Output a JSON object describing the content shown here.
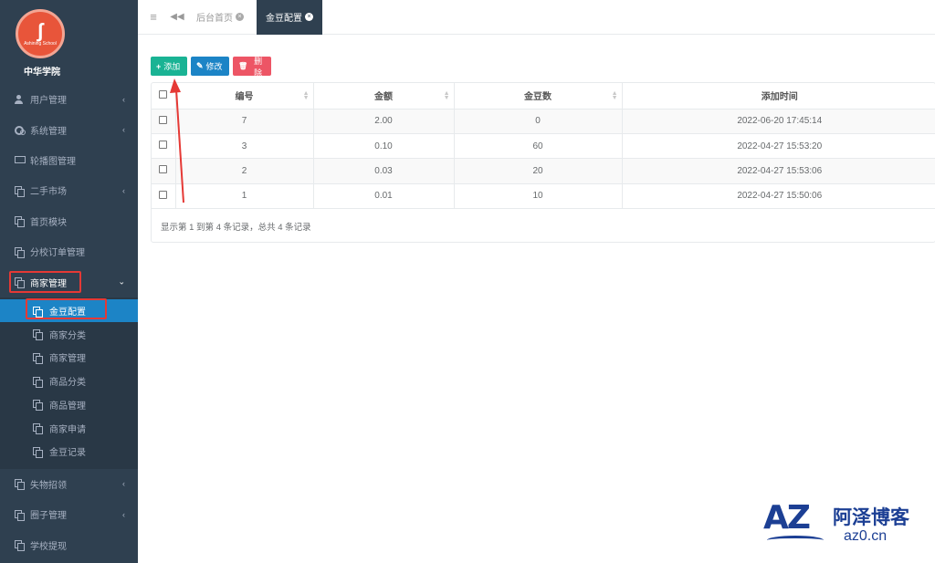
{
  "logo": {
    "glyph": "ʃ",
    "sub": "Ashining School",
    "name": "中华学院"
  },
  "sidebar": {
    "items": [
      {
        "label": "用户管理",
        "icon": "user-icon",
        "chevron": "‹"
      },
      {
        "label": "系统管理",
        "icon": "cogs-icon",
        "chevron": "‹"
      },
      {
        "label": "轮播图管理",
        "icon": "desktop-icon",
        "chevron": ""
      },
      {
        "label": "二手市场",
        "icon": "copy-icon",
        "chevron": "‹"
      },
      {
        "label": "首页模块",
        "icon": "copy-icon",
        "chevron": ""
      },
      {
        "label": "分校订单管理",
        "icon": "copy-icon",
        "chevron": ""
      },
      {
        "label": "商家管理",
        "icon": "copy-icon",
        "chevron": "⌄"
      }
    ],
    "sub_items": [
      {
        "label": "金豆配置",
        "active": true
      },
      {
        "label": "商家分类"
      },
      {
        "label": "商家管理"
      },
      {
        "label": "商品分类"
      },
      {
        "label": "商品管理"
      },
      {
        "label": "商家申请"
      },
      {
        "label": "金豆记录"
      }
    ],
    "bottom_items": [
      {
        "label": "失物招领",
        "chevron": "‹"
      },
      {
        "label": "圈子管理",
        "chevron": "‹"
      },
      {
        "label": "学校提现",
        "chevron": ""
      }
    ]
  },
  "tabs": {
    "home": "后台首页",
    "active": "金豆配置",
    "close_glyph": "×",
    "menu_glyph": "≡",
    "back_glyph": "◀◀"
  },
  "toolbar": {
    "add": "添加",
    "add_glyph": "+",
    "edit": "修改",
    "edit_glyph": "✎",
    "delete": "删除",
    "delete_glyph": "🗑"
  },
  "table": {
    "headers": [
      "编号",
      "金额",
      "金豆数",
      "添加时间"
    ],
    "rows": [
      [
        "7",
        "2.00",
        "0",
        "2022-06-20 17:45:14"
      ],
      [
        "3",
        "0.10",
        "60",
        "2022-04-27 15:53:20"
      ],
      [
        "2",
        "0.03",
        "20",
        "2022-04-27 15:53:06"
      ],
      [
        "1",
        "0.01",
        "10",
        "2022-04-27 15:50:06"
      ]
    ],
    "pager": "显示第 1 到第 4 条记录，总共 4 条记录"
  },
  "watermark": {
    "logo": "AZ",
    "cn": "阿泽博客",
    "url": "az0.cn"
  },
  "colors": {
    "sidebar": "#2f4050",
    "active": "#1c84c6",
    "add": "#1ab394",
    "edit": "#1c84c6",
    "delete": "#ed5565",
    "highlight": "#e53935"
  }
}
